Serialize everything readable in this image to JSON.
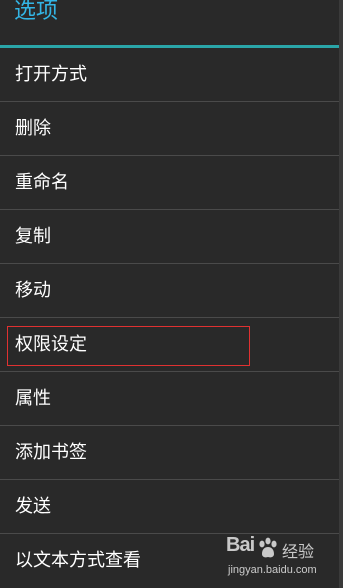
{
  "dialog": {
    "title": "选项"
  },
  "menu": {
    "items": [
      {
        "label": "打开方式"
      },
      {
        "label": "删除"
      },
      {
        "label": "重命名"
      },
      {
        "label": "复制"
      },
      {
        "label": "移动"
      },
      {
        "label": "权限设定",
        "highlighted": true
      },
      {
        "label": "属性"
      },
      {
        "label": "添加书签"
      },
      {
        "label": "发送"
      },
      {
        "label": "以文本方式查看"
      }
    ]
  },
  "watermark": {
    "logo": "Bai",
    "logo_tail": "",
    "brand": "经验",
    "url": "jingyan.baidu.com"
  },
  "colors": {
    "title": "#33b5e5",
    "divider": "#2aa5a8",
    "highlight": "#e03131",
    "background": "#292929"
  }
}
